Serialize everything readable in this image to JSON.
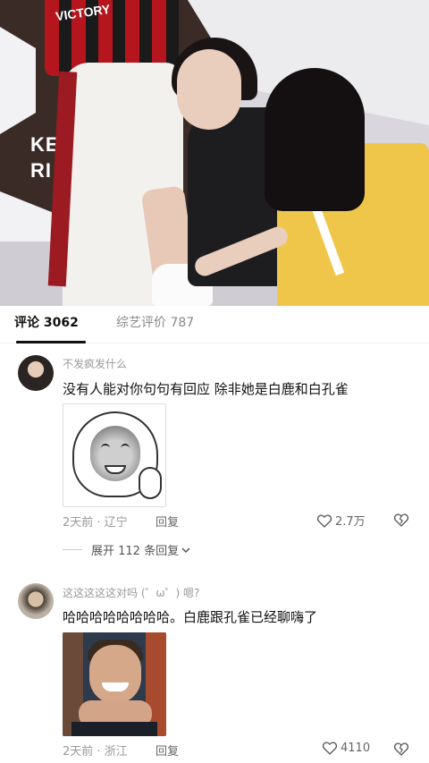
{
  "media": {
    "jersey_text": "VICTORY",
    "backdrop_text_1": "KE",
    "backdrop_text_2": "RI"
  },
  "tabs": [
    {
      "label": "评论 3062",
      "active": true
    },
    {
      "label": "综艺评价 787",
      "active": false
    }
  ],
  "comments": [
    {
      "username": "不发疯发什么",
      "text": "没有人能对你句句有回应 除非她是白鹿和白孔雀",
      "meta": "2天前 · 辽宁",
      "reply_label": "回复",
      "likes": "2.7万",
      "expand_label": "展开 112 条回复",
      "sticker": "meme-face-sticker"
    },
    {
      "username": "这这这这这对吗 (゜ω゜) 嗯?",
      "text": "哈哈哈哈哈哈哈哈。白鹿跟孔雀已经聊嗨了",
      "meta": "2天前 · 浙江",
      "reply_label": "回复",
      "likes": "4110",
      "sticker": "laughing-man-photo"
    }
  ],
  "colors": {
    "text_primary": "#111111",
    "text_secondary": "#999999",
    "tab_underline": "#111111"
  }
}
